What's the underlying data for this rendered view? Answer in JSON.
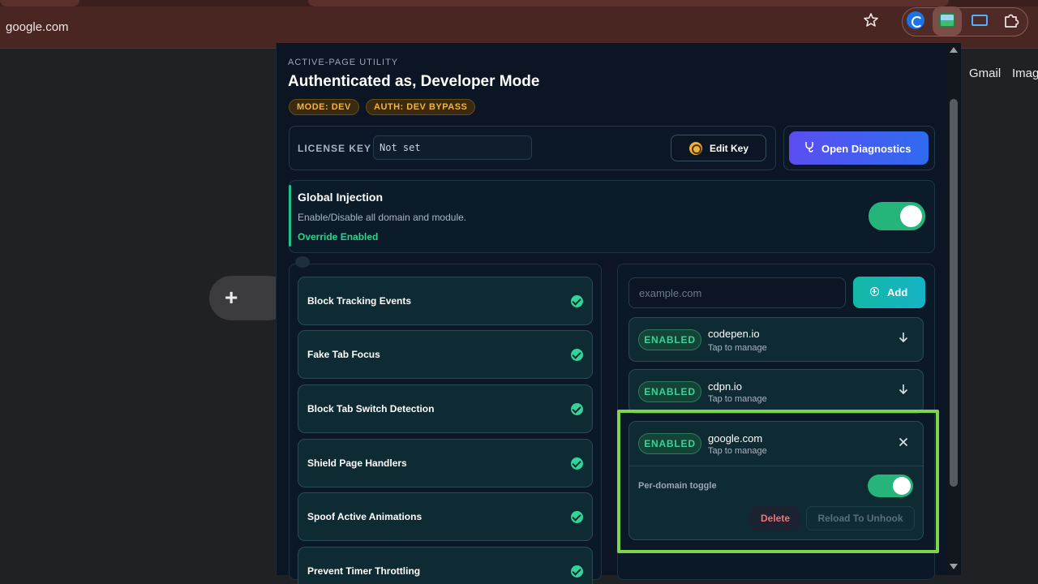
{
  "browser": {
    "address": "google.com"
  },
  "google_page": {
    "links": [
      "Gmail",
      "Image"
    ],
    "add_shortcut_glyph": "+"
  },
  "popup": {
    "kicker": "ACTIVE-PAGE UTILITY",
    "title": "Authenticated as, Developer Mode",
    "badges": [
      "MODE: DEV",
      "AUTH: DEV BYPASS"
    ],
    "license": {
      "label": "LICENSE KEY",
      "value": "Not set",
      "edit_label": "Edit Key",
      "diagnostics_label": "Open Diagnostics"
    },
    "global": {
      "title": "Global Injection",
      "description": "Enable/Disable all domain and module.",
      "status": "Override Enabled",
      "enabled": true
    },
    "modules": [
      "Block Tracking Events",
      "Fake Tab Focus",
      "Block Tab Switch Detection",
      "Shield Page Handlers",
      "Spoof Active Animations",
      "Prevent Timer Throttling"
    ],
    "domains": {
      "input_placeholder": "example.com",
      "add_label": "Add",
      "items": [
        {
          "status": "ENABLED",
          "name": "codepen.io",
          "sub": "Tap to manage"
        },
        {
          "status": "ENABLED",
          "name": "cdpn.io",
          "sub": "Tap to manage"
        },
        {
          "status": "ENABLED",
          "name": "google.com",
          "sub": "Tap to manage"
        }
      ],
      "expanded": {
        "toggle_label": "Per-domain toggle",
        "toggle_on": true,
        "delete_label": "Delete",
        "reload_label": "Reload To Unhook"
      }
    }
  },
  "colors": {
    "accent_green": "#25b57b",
    "badge_amber": "#f3b33c",
    "highlight": "#7ed34f",
    "diagnostics_gradient": "#5b4ef0"
  },
  "icons": [
    "star-icon",
    "key-icon",
    "stethoscope-icon",
    "check-icon",
    "plus-circle-icon",
    "arrow-down-icon",
    "close-icon"
  ]
}
